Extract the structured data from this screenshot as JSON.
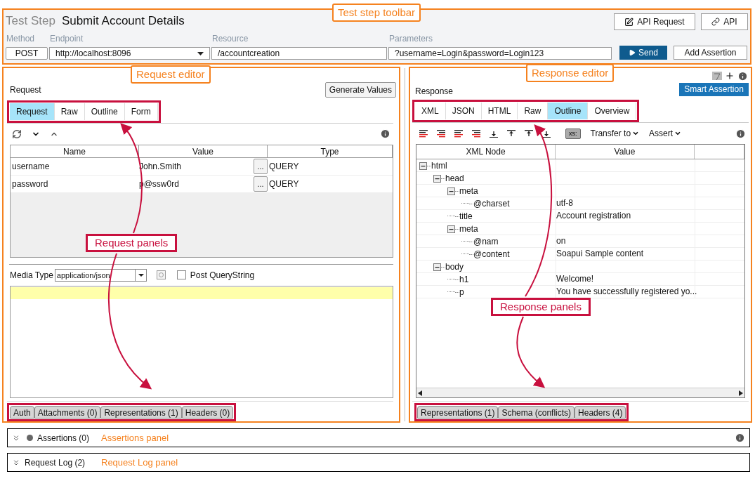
{
  "toolbar": {
    "annotation": "Test step toolbar",
    "kind_label": "Test Step",
    "title": "Submit Account Details",
    "buttons": [
      {
        "kind": "edit",
        "label": "API Request"
      },
      {
        "kind": "link",
        "label": "API"
      }
    ],
    "fields": [
      {
        "label": "Method",
        "value": "POST",
        "kind": "method"
      },
      {
        "label": "Endpoint",
        "value": "http://localhost:8096",
        "kind": "dropdown"
      },
      {
        "label": "Resource",
        "value": "/accountcreation",
        "kind": "text"
      },
      {
        "label": "Parameters",
        "value": "?username=Login&password=Login123",
        "kind": "text"
      }
    ],
    "send": "Send",
    "add_assertion": "Add Assertion"
  },
  "request_editor": {
    "annotation": "Request editor",
    "title": "Request",
    "generate_button": "Generate Values",
    "tabs": [
      {
        "label": "Request",
        "selected": true
      },
      {
        "label": "Raw",
        "selected": false
      },
      {
        "label": "Outline",
        "selected": false
      },
      {
        "label": "Form",
        "selected": false
      }
    ],
    "panels_callout": "Request panels",
    "table": {
      "columns": [
        "Name",
        "Value",
        "Type"
      ],
      "rows": [
        {
          "name": "username",
          "value": "John.Smith",
          "button": "...",
          "type": "QUERY"
        },
        {
          "name": "password",
          "value": "p@ssw0rd",
          "button": "...",
          "type": "QUERY"
        }
      ]
    },
    "media_type": {
      "label": "Media Type",
      "value": "application/json"
    },
    "post_querystring": {
      "label": "Post QueryString",
      "checked": false
    },
    "bottom_tabs": [
      "Auth",
      "Attachments (0)",
      "Representations (1)",
      "Headers (0)"
    ]
  },
  "response_editor": {
    "annotation": "Response editor",
    "title": "Response",
    "smart_assertion": "Smart Assertion",
    "tabs": [
      {
        "label": "XML",
        "selected": false
      },
      {
        "label": "JSON",
        "selected": false
      },
      {
        "label": "HTML",
        "selected": false
      },
      {
        "label": "Raw",
        "selected": false
      },
      {
        "label": "Outline",
        "selected": true
      },
      {
        "label": "Overview",
        "selected": false
      }
    ],
    "xs_button": "xs:",
    "menus": [
      "Transfer to",
      "Assert"
    ],
    "panels_callout": "Response panels",
    "tree_columns": [
      "XML Node",
      "Value"
    ],
    "tree": [
      {
        "node": "html",
        "expanded": true,
        "children": [
          {
            "node": "head",
            "expanded": true,
            "children": [
              {
                "node": "meta",
                "expanded": true,
                "children": [
                  {
                    "node": "@charset",
                    "value": "utf-8"
                  }
                ]
              },
              {
                "node": "title",
                "value": "Account registration"
              },
              {
                "node": "meta",
                "expanded": true,
                "children": [
                  {
                    "node": "@nam",
                    "value": "on"
                  },
                  {
                    "node": "@content",
                    "value": "Soapui Sample content"
                  }
                ]
              }
            ]
          },
          {
            "node": "body",
            "expanded": true,
            "children": [
              {
                "node": "h1",
                "value": "Welcome!"
              },
              {
                "node": "p",
                "value": "You have successfully registered yo..."
              }
            ]
          }
        ]
      }
    ],
    "bottom_tabs": [
      "Representations (1)",
      "Schema (conflicts)",
      "Headers (4)"
    ]
  },
  "assertions_bar": {
    "label": "Assertions (0)",
    "annotation": "Assertions panel"
  },
  "request_log_bar": {
    "label": "Request Log (2)",
    "annotation": "Request Log panel"
  }
}
